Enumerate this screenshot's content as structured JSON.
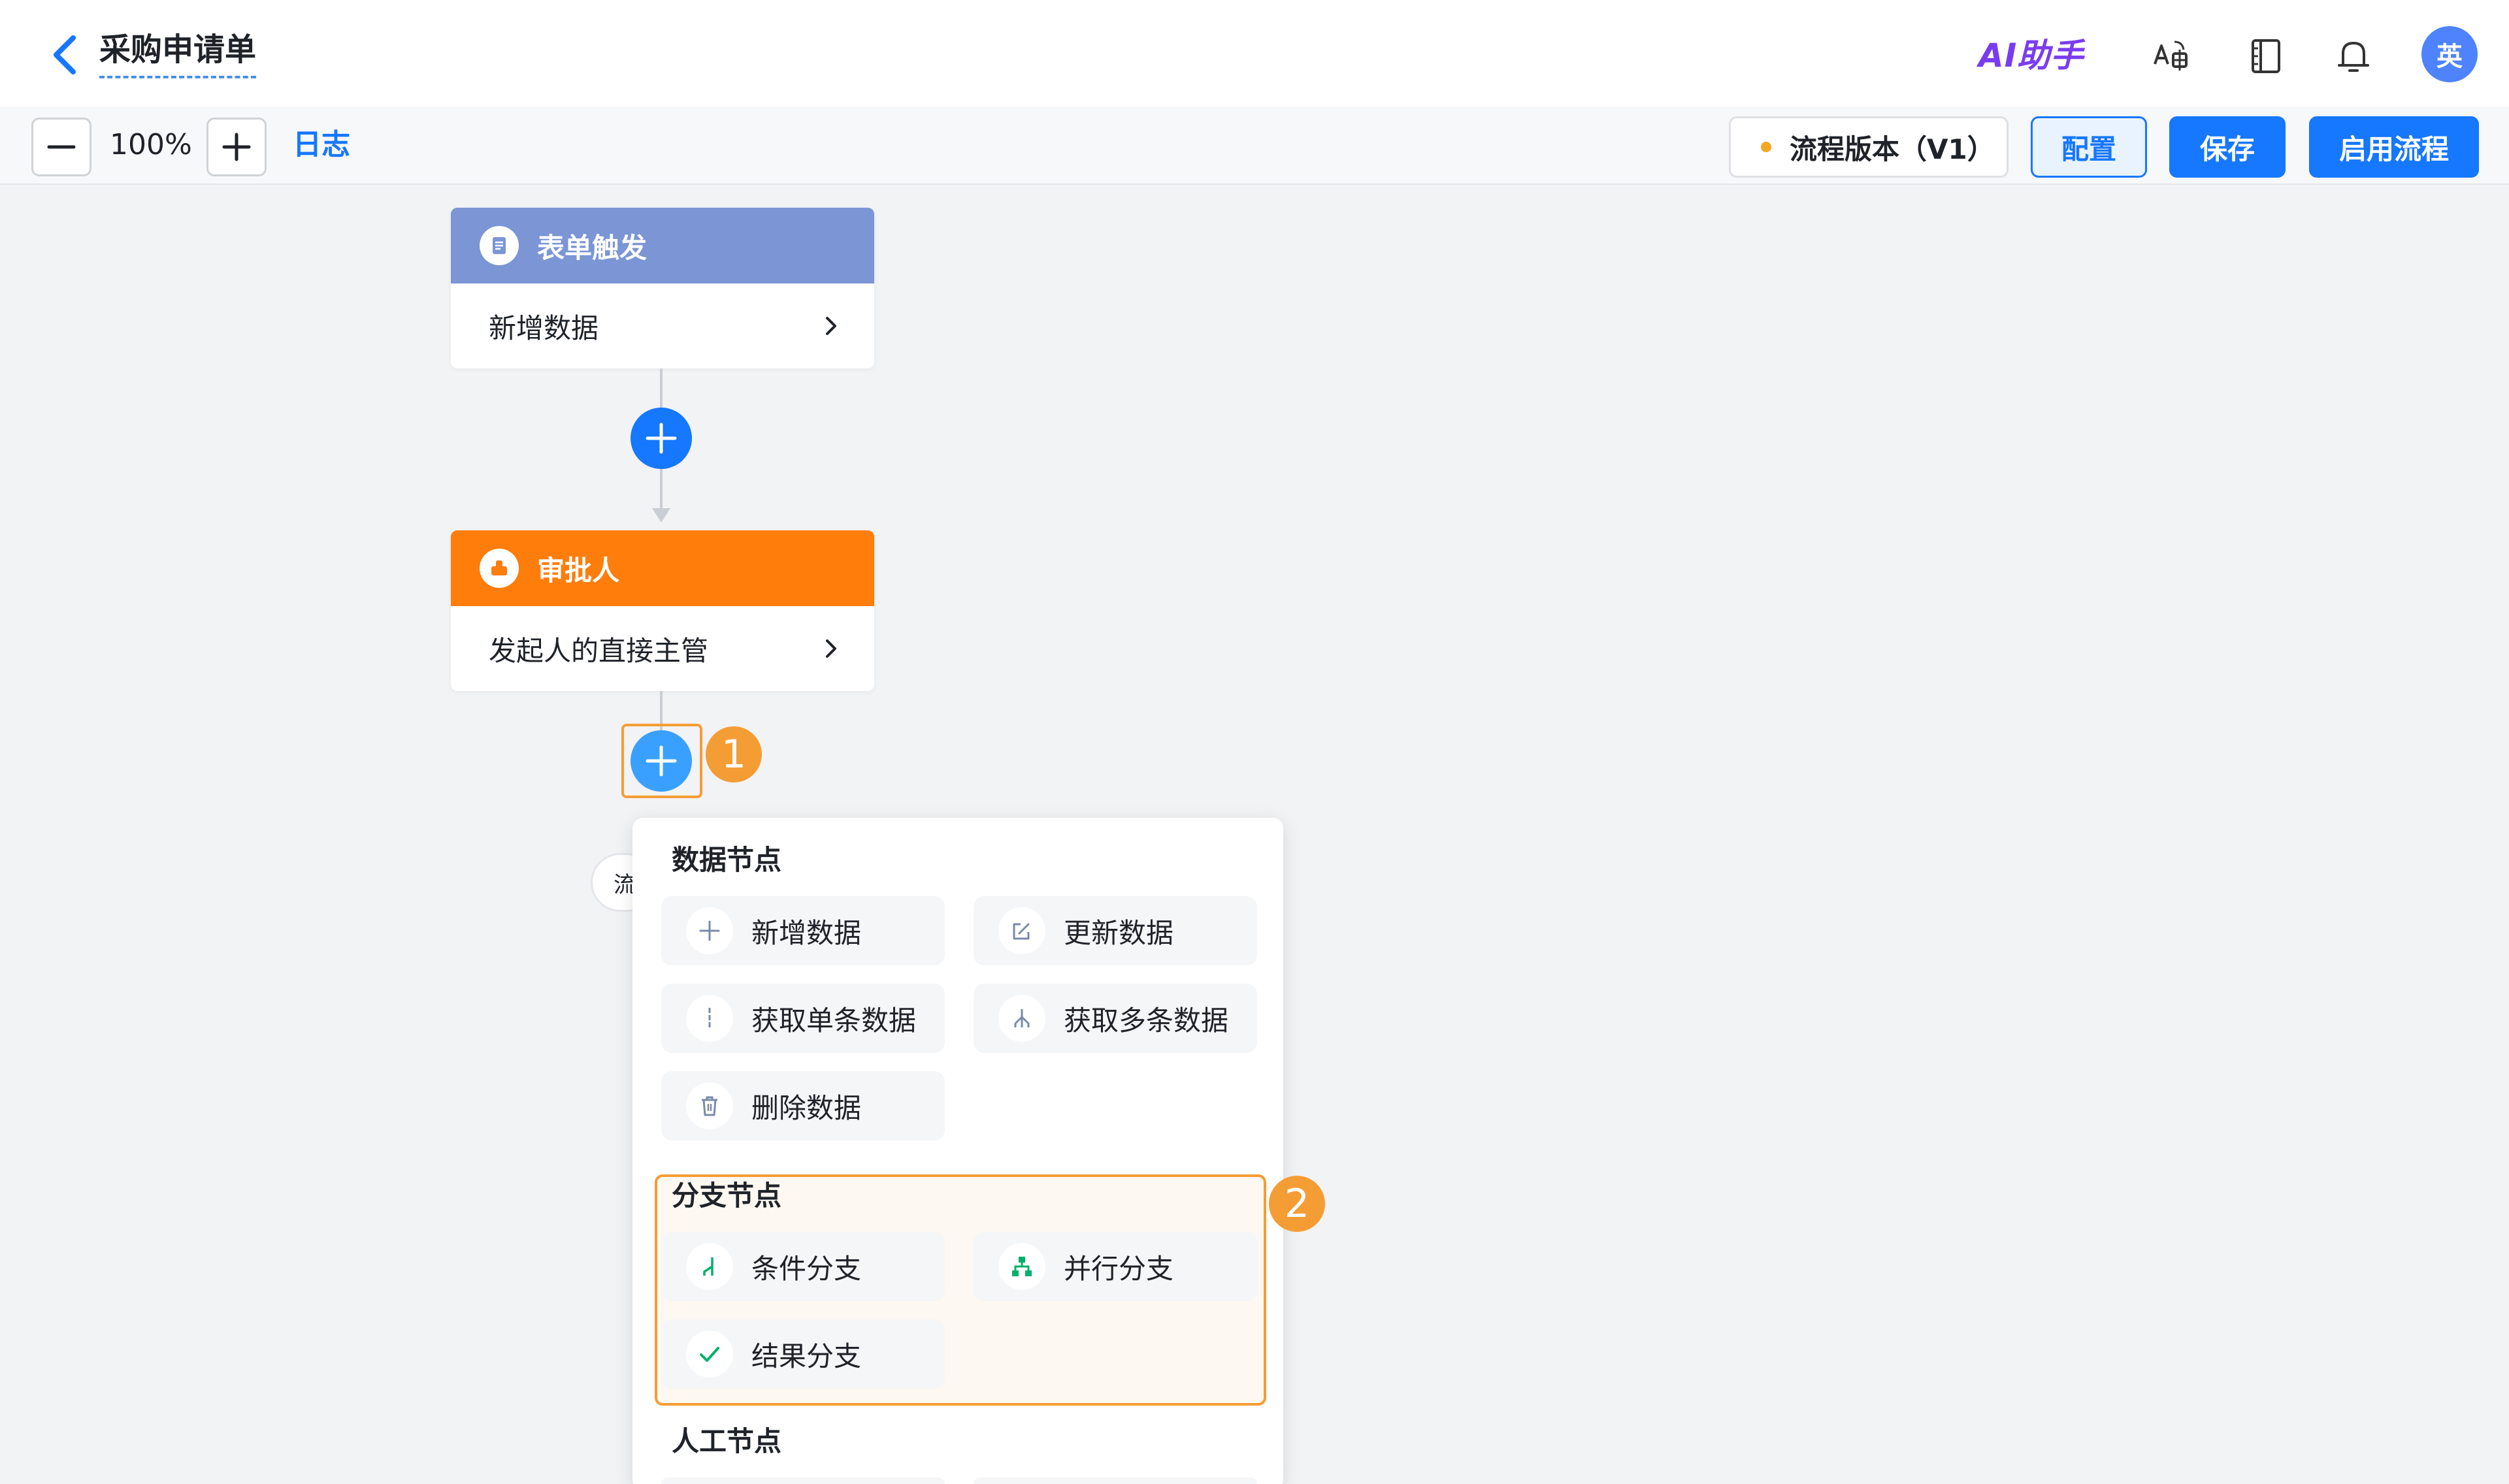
{
  "header": {
    "title": "采购申请单",
    "ai_assistant": "AI助手",
    "avatar_text": "英"
  },
  "toolbar": {
    "zoom_value": "100%",
    "log_label": "日志",
    "version_label": "流程版本（V1）",
    "config_label": "配置",
    "save_label": "保存",
    "enable_label": "启用流程"
  },
  "flow": {
    "trigger_card": {
      "title": "表单触发",
      "body": "新增数据"
    },
    "approver_card": {
      "title": "审批人",
      "body": "发起人的直接主管"
    },
    "hidden_pill_text": "流"
  },
  "annotations": {
    "badge_1": "1",
    "badge_2": "2"
  },
  "node_menu": {
    "data_section": {
      "title": "数据节点",
      "items": [
        {
          "label": "新增数据",
          "icon": "plus-icon"
        },
        {
          "label": "更新数据",
          "icon": "edit-icon"
        },
        {
          "label": "获取单条数据",
          "icon": "single-data-icon"
        },
        {
          "label": "获取多条数据",
          "icon": "multi-data-icon"
        },
        {
          "label": "删除数据",
          "icon": "trash-icon"
        }
      ]
    },
    "branch_section": {
      "title": "分支节点",
      "items": [
        {
          "label": "条件分支",
          "icon": "condition-branch-icon"
        },
        {
          "label": "并行分支",
          "icon": "parallel-branch-icon"
        },
        {
          "label": "结果分支",
          "icon": "check-icon"
        }
      ]
    },
    "manual_section": {
      "title": "人工节点"
    }
  },
  "colors": {
    "primary": "#1677ff",
    "trigger_header": "#7b95d5",
    "approver_header": "#ff7d0a",
    "highlight": "#f59d35",
    "branch_icon": "#00b06b"
  }
}
